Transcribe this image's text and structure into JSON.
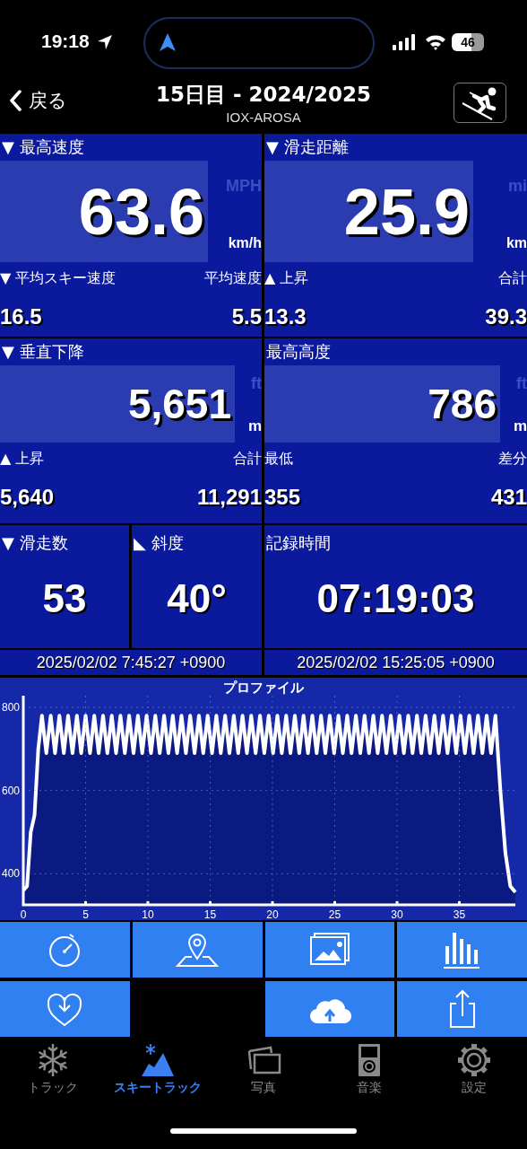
{
  "status_bar": {
    "time": "19:18",
    "battery": "46"
  },
  "nav": {
    "back": "戻る",
    "title": "15日目 - 2024/2025",
    "subtitle": "IOX-AROSA"
  },
  "rows": [
    {
      "panels": [
        {
          "title": "▼ 最高速度",
          "value": "63.6",
          "unit_alt": "MPH",
          "unit": "km/h",
          "sub_left": {
            "label": "▼ 平均スキー速度",
            "value": "16.5"
          },
          "sub_right": {
            "label": "平均速度",
            "value": "5.5"
          }
        },
        {
          "title": "▼ 滑走距離",
          "value": "25.9",
          "unit_alt": "mi",
          "unit": "km",
          "sub_left": {
            "label": "▲ 上昇",
            "value": "13.3"
          },
          "sub_right": {
            "label": "合計",
            "value": "39.3"
          }
        }
      ]
    },
    {
      "panels": [
        {
          "title": "▼ 垂直下降",
          "value": "5,651",
          "unit_alt": "ft",
          "unit": "m",
          "sub_left": {
            "label": "▲ 上昇",
            "value": "5,640"
          },
          "sub_right": {
            "label": "合計",
            "value": "11,291"
          }
        },
        {
          "title": "最高高度",
          "value": "786",
          "unit_alt": "ft",
          "unit": "m",
          "sub_left": {
            "label": "最低",
            "value": "355"
          },
          "sub_right": {
            "label": "差分",
            "value": "431"
          }
        }
      ]
    },
    {
      "panels": [
        {
          "title": "▼ 滑走数",
          "value": "53"
        },
        {
          "title": "◣ 斜度",
          "value": "40°"
        },
        {
          "title": "記録時間",
          "value": "07:19:03"
        }
      ]
    }
  ],
  "dates": [
    "2025/02/02 7:45:27 +0900",
    "2025/02/02 15:25:05 +0900"
  ],
  "profile": {
    "chart_data": {
      "type": "line",
      "title": "プロファイル",
      "xlim": [
        0,
        39.5
      ],
      "ylim": [
        325,
        828
      ],
      "xticks": [
        0,
        5,
        10,
        15,
        20,
        25,
        30,
        35
      ],
      "yticks": [
        400,
        600,
        800
      ],
      "grid": true,
      "x": [
        0,
        0.3,
        0.6,
        0.9,
        1.2,
        1.5,
        1.85,
        2.2,
        2.55,
        2.9,
        3.25,
        3.6,
        3.95,
        4.3,
        4.65,
        5,
        5.35,
        5.7,
        6.05,
        6.4,
        6.75,
        7.1,
        7.45,
        7.8,
        8.15,
        8.5,
        8.85,
        9.2,
        9.55,
        9.9,
        10.25,
        10.6,
        10.95,
        11.3,
        11.65,
        12,
        12.35,
        12.7,
        13.05,
        13.4,
        13.75,
        14.1,
        14.45,
        14.8,
        15.15,
        15.5,
        15.85,
        16.2,
        16.55,
        16.9,
        17.25,
        17.6,
        17.95,
        18.3,
        18.65,
        19,
        19.35,
        19.7,
        20.05,
        20.4,
        20.75,
        21.1,
        21.45,
        21.8,
        22.15,
        22.5,
        22.85,
        23.2,
        23.55,
        23.9,
        24.25,
        24.6,
        24.95,
        25.3,
        25.65,
        26,
        26.35,
        26.7,
        27.05,
        27.4,
        27.75,
        28.1,
        28.45,
        28.8,
        29.15,
        29.5,
        29.85,
        30.2,
        30.55,
        30.9,
        31.25,
        31.6,
        31.95,
        32.3,
        32.65,
        33,
        33.35,
        33.7,
        34.05,
        34.4,
        34.75,
        35.1,
        35.45,
        35.8,
        36.15,
        36.5,
        36.85,
        37.2,
        37.55,
        37.9,
        38.3,
        38.7,
        39.1,
        39.5
      ],
      "series": [
        {
          "values": [
            360,
            370,
            500,
            540,
            700,
            780,
            690,
            780,
            690,
            780,
            690,
            780,
            690,
            780,
            690,
            780,
            690,
            780,
            690,
            780,
            690,
            780,
            690,
            780,
            690,
            780,
            690,
            780,
            690,
            780,
            690,
            780,
            690,
            780,
            690,
            780,
            690,
            780,
            690,
            780,
            690,
            780,
            690,
            780,
            690,
            780,
            690,
            780,
            690,
            780,
            690,
            780,
            690,
            780,
            690,
            780,
            690,
            780,
            690,
            780,
            690,
            780,
            690,
            780,
            690,
            780,
            690,
            780,
            690,
            780,
            690,
            780,
            690,
            780,
            690,
            780,
            690,
            780,
            690,
            780,
            690,
            780,
            690,
            780,
            690,
            780,
            690,
            780,
            690,
            780,
            690,
            780,
            690,
            780,
            690,
            780,
            690,
            780,
            690,
            780,
            690,
            780,
            690,
            780,
            690,
            780,
            690,
            780,
            690,
            780,
            600,
            450,
            370,
            355
          ]
        }
      ]
    }
  },
  "actions": [
    {
      "kind": "stopwatch"
    },
    {
      "kind": "pin"
    },
    {
      "kind": "photos"
    },
    {
      "kind": "bars"
    },
    {
      "kind": "heart"
    },
    {
      "kind": "blank"
    },
    {
      "kind": "cloud"
    },
    {
      "kind": "share"
    }
  ],
  "tabs": [
    {
      "label": "トラック",
      "kind": "snowflake",
      "selected": false
    },
    {
      "label": "スキートラック",
      "kind": "mountain",
      "selected": true
    },
    {
      "label": "写真",
      "kind": "photos",
      "selected": false
    },
    {
      "label": "音楽",
      "kind": "player",
      "selected": false
    },
    {
      "label": "設定",
      "kind": "gear",
      "selected": false
    }
  ]
}
